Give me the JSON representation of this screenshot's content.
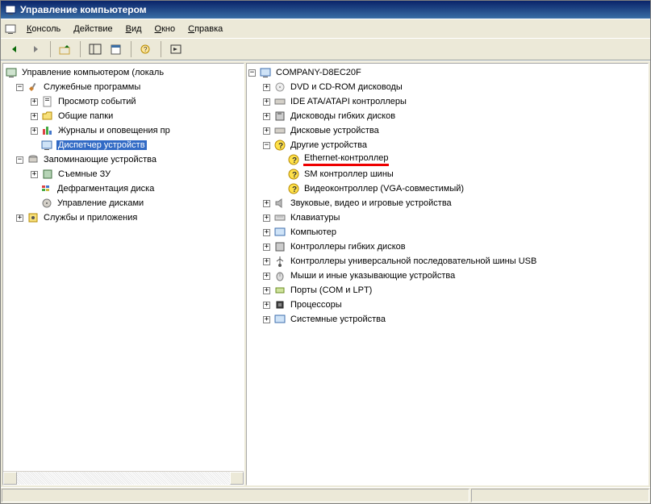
{
  "titlebar": {
    "title": "Управление компьютером"
  },
  "menu": {
    "console": "Консоль",
    "action": "Действие",
    "view": "Вид",
    "window": "Окно",
    "help": "Справка"
  },
  "left_tree": {
    "root": "Управление компьютером (локаль",
    "system_tools": "Служебные программы",
    "event_viewer": "Просмотр событий",
    "shared_folders": "Общие папки",
    "perf_logs": "Журналы и оповещения пр",
    "device_manager": "Диспетчер устройств",
    "storage": "Запоминающие устройства",
    "removable": "Съемные ЗУ",
    "defrag": "Дефрагментация диска",
    "disk_mgmt": "Управление дисками",
    "services": "Службы и приложения"
  },
  "right_tree": {
    "root": "COMPANY-D8EC20F",
    "dvd": "DVD и CD-ROM дисководы",
    "ide": "IDE ATA/ATAPI контроллеры",
    "floppy_drv": "Дисководы гибких дисков",
    "disk_drives": "Дисковые устройства",
    "other": "Другие устройства",
    "ethernet": "Ethernet-контроллер",
    "sm_bus": "SM контроллер шины",
    "video": "Видеоконтроллер (VGA-совместимый)",
    "sound": "Звуковые, видео и игровые устройства",
    "keyboards": "Клавиатуры",
    "computer": "Компьютер",
    "floppy_ctrl": "Контроллеры гибких дисков",
    "usb": "Контроллеры универсальной последовательной шины USB",
    "mice": "Мыши и иные указывающие устройства",
    "ports": "Порты (COM и LPT)",
    "cpu": "Процессоры",
    "system": "Системные устройства"
  }
}
